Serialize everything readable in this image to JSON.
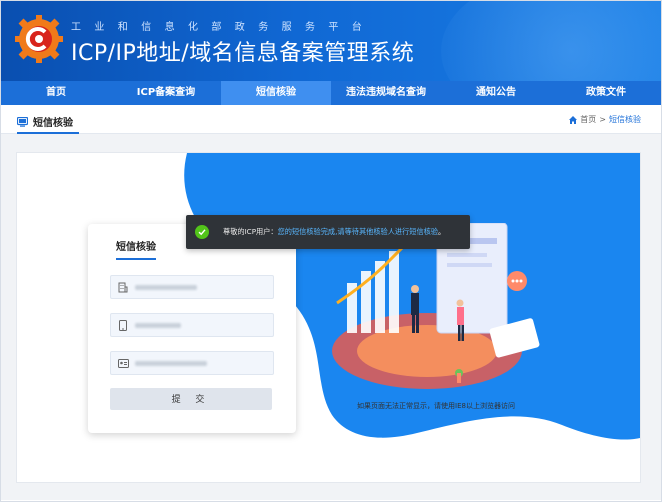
{
  "header": {
    "subtitle": "工业和信息化部政务服务平台",
    "title": "ICP/IP地址/域名信息备案管理系统"
  },
  "nav": {
    "items": [
      {
        "label": "首页"
      },
      {
        "label": "ICP备案查询"
      },
      {
        "label": "短信核验",
        "active": true
      },
      {
        "label": "违法违规域名查询"
      },
      {
        "label": "通知公告"
      },
      {
        "label": "政策文件"
      }
    ]
  },
  "page_tab": {
    "label": "短信核验"
  },
  "breadcrumb": {
    "home": "首页",
    "separator": ">",
    "current": "短信核验"
  },
  "form": {
    "title": "短信核验",
    "submit_label": "提 交"
  },
  "toast": {
    "prefix": "尊敬的ICP用户：",
    "highlight": "您的短信核验完成,请等待其他核验人进行短信核验",
    "suffix": "。"
  },
  "compat_note": "如果页面无法正常显示，请使用IE8以上浏览器访问",
  "colors": {
    "primary": "#1c6fd8",
    "success": "#52c41a",
    "wave": "#1a86f0"
  }
}
